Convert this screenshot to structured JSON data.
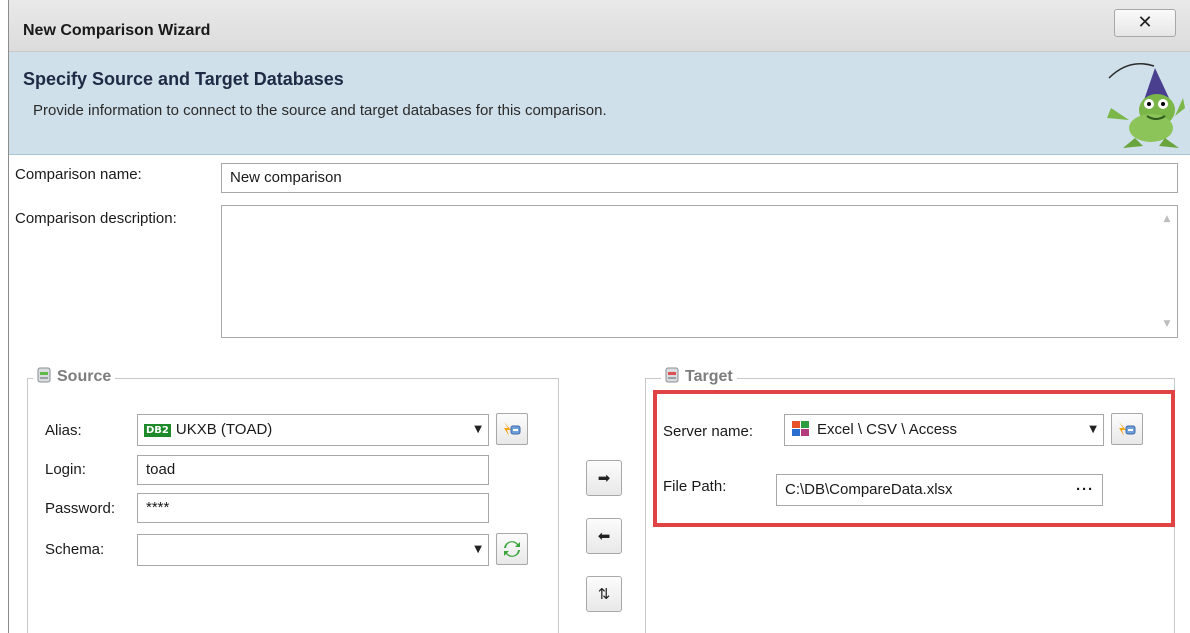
{
  "window": {
    "title": "New Comparison Wizard",
    "close_label": "✕"
  },
  "header": {
    "title": "Specify Source and Target Databases",
    "subtitle": "Provide information to connect to the source and target databases for this comparison."
  },
  "comparison": {
    "name_label": "Comparison name:",
    "name_value": "New comparison",
    "description_label": "Comparison description:",
    "description_value": ""
  },
  "source": {
    "legend": "Source",
    "alias_label": "Alias:",
    "alias_badge": "DB2",
    "alias_value": "UKXB (TOAD)",
    "login_label": "Login:",
    "login_value": "toad",
    "password_label": "Password:",
    "password_value": "****",
    "schema_label": "Schema:",
    "schema_value": ""
  },
  "target": {
    "legend": "Target",
    "server_label": "Server name:",
    "server_value": "Excel \\ CSV \\ Access",
    "filepath_label": "File Path:",
    "filepath_value": "C:\\DB\\CompareData.xlsx",
    "browse_label": "···"
  },
  "move_buttons": {
    "right": "➡",
    "left": "⬅",
    "swap": "⇅"
  },
  "colors": {
    "header_band": "#cfe0ea",
    "highlight_border": "#e04343",
    "legend_text": "#7d7d7d"
  }
}
